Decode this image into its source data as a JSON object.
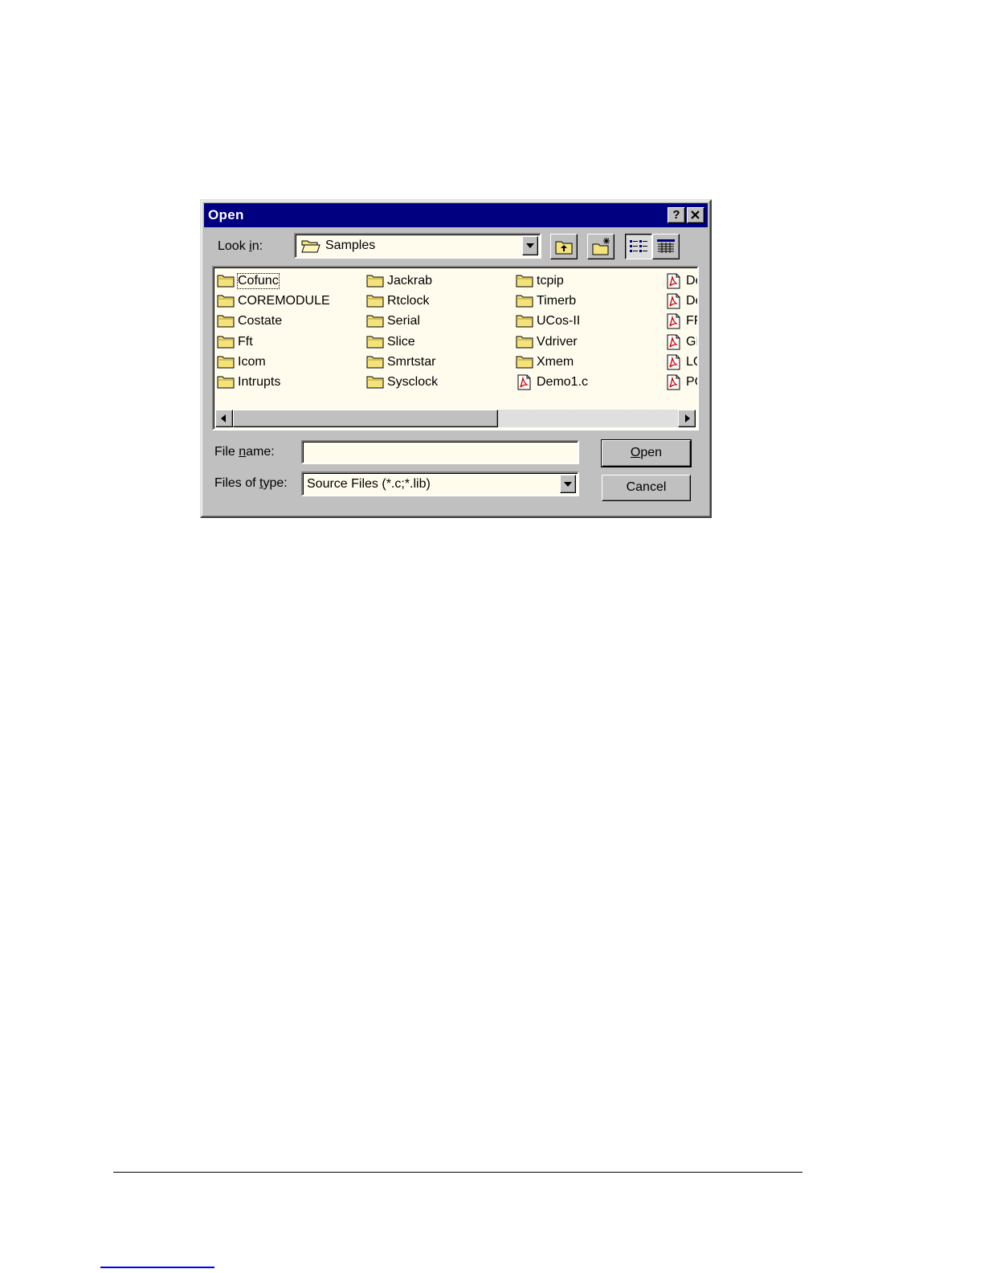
{
  "dialog": {
    "title": "Open",
    "help_glyph": "?",
    "close_glyph": "✕"
  },
  "look_in": {
    "label_pre": "Look ",
    "label_key": "i",
    "label_post": "n:",
    "value": "Samples",
    "icon": "folder-open-icon"
  },
  "toolbar": {
    "up_one_level_icon": "folder-up-icon",
    "new_folder_icon": "new-folder-icon",
    "list_view_icon": "list-view-icon",
    "details_view_icon": "details-view-icon"
  },
  "files": {
    "col1": [
      "Cofunc",
      "COREMODULE",
      "Costate",
      "Fft",
      "Icom",
      "Intrupts"
    ],
    "col2": [
      "Jackrab",
      "Rtclock",
      "Serial",
      "Slice",
      "Smrtstar",
      "Sysclock"
    ],
    "col3": [
      "tcpip",
      "Timerb",
      "UCos-II",
      "Vdriver",
      "Xmem"
    ],
    "col3_file": "Demo1.c",
    "col4": [
      "De",
      "De",
      "FF",
      "GL",
      "LC",
      "PC"
    ]
  },
  "file_name": {
    "label_pre": "File ",
    "label_key": "n",
    "label_post": "ame:",
    "value": ""
  },
  "files_of_type": {
    "label_pre": "Files of ",
    "label_key": "t",
    "label_post": "ype:",
    "value": "Source Files (*.c;*.lib)"
  },
  "buttons": {
    "open_key": "O",
    "open_rest": "pen",
    "cancel": "Cancel"
  },
  "colors": {
    "titlebar": "#000080",
    "face": "#c0c0c0",
    "field": "#fffcee",
    "folder": "#f4e27a"
  }
}
